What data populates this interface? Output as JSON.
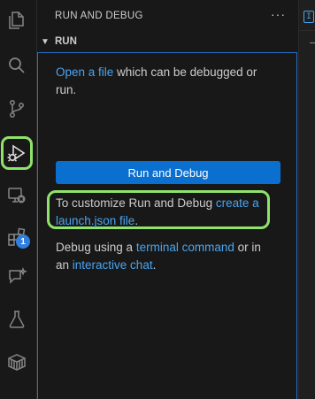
{
  "activity_bar": {
    "icons": [
      "explorer-icon",
      "search-icon",
      "source-control-icon",
      "run-debug-icon",
      "remote-explorer-icon",
      "extensions-icon",
      "chat-icon",
      "testing-icon",
      "containers-icon"
    ],
    "extensions_badge": "1"
  },
  "sidebar": {
    "header": "RUN AND DEBUG",
    "more_actions": "···",
    "section_title": "RUN",
    "open_file_link": "Open a file",
    "open_file_rest": " which can be debugged or run.",
    "run_button_label": "Run and Debug",
    "customize_prefix": "To customize Run and Debug ",
    "customize_link": "create a launch.json file",
    "customize_suffix": ".",
    "debug_prefix": "Debug using a ",
    "terminal_link": "terminal command",
    "debug_middle": " or in an ",
    "chat_link": "interactive chat",
    "debug_suffix": "."
  },
  "editor": {
    "tab_glyph": "I"
  },
  "colors": {
    "background": "#181818",
    "link": "#4aa4f0",
    "button": "#0b6fd0",
    "highlight": "#8fe36a",
    "focus_border": "#2a6fc9"
  }
}
